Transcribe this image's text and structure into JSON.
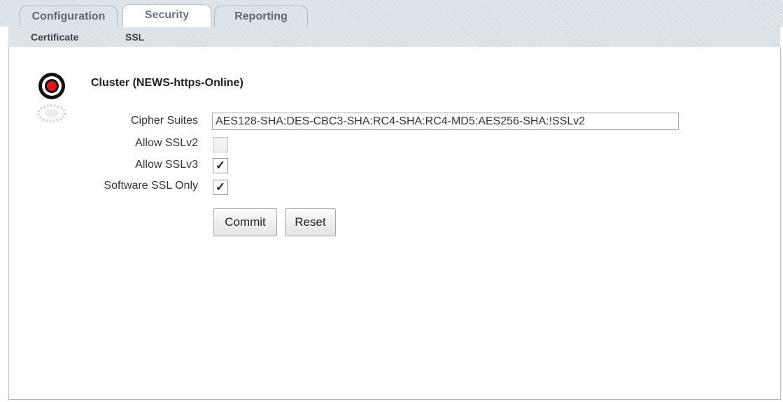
{
  "tabs": [
    {
      "label": "Configuration",
      "active": false
    },
    {
      "label": "Security",
      "active": true
    },
    {
      "label": "Reporting",
      "active": false
    }
  ],
  "subtabs": [
    {
      "label": "Certificate"
    },
    {
      "label": "SSL"
    }
  ],
  "cluster": {
    "title": "Cluster (NEWS-https-Online)",
    "icon": "target-icon"
  },
  "form": {
    "cipher_suites_label": "Cipher Suites",
    "cipher_suites_value": "AES128-SHA:DES-CBC3-SHA:RC4-SHA:RC4-MD5:AES256-SHA:!SSLv2",
    "allow_sslv2_label": "Allow SSLv2",
    "allow_sslv2_checked": false,
    "allow_sslv3_label": "Allow SSLv3",
    "allow_sslv3_checked": true,
    "software_ssl_only_label": "Software SSL Only",
    "software_ssl_only_checked": true
  },
  "buttons": {
    "commit": "Commit",
    "reset": "Reset"
  },
  "colors": {
    "tab_pattern": "#d4dde3",
    "border": "#b3bbc0",
    "icon_red": "#e0141b"
  }
}
